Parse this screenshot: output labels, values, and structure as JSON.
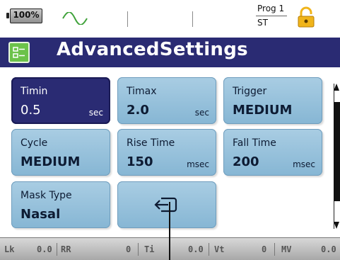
{
  "status": {
    "battery": "100%",
    "prog_label": "Prog 1",
    "mode": "ST",
    "icons": [
      "battery-icon",
      "wave-icon",
      "lock-icon"
    ]
  },
  "title": {
    "text": "AdvancedSettings",
    "icon": "settings-form-icon"
  },
  "tiles": [
    {
      "label": "Timin",
      "value": "0.5",
      "unit": "sec"
    },
    {
      "label": "Timax",
      "value": "2.0",
      "unit": "sec"
    },
    {
      "label": "Trigger",
      "value": "MEDIUM",
      "unit": ""
    },
    {
      "label": "Cycle",
      "value": "MEDIUM",
      "unit": ""
    },
    {
      "label": "Rise Time",
      "value": "150",
      "unit": "msec"
    },
    {
      "label": "Fall Time",
      "value": "200",
      "unit": "msec"
    },
    {
      "label": "Mask Type",
      "value": "Nasal",
      "unit": ""
    }
  ],
  "back_button_icon": "exit-arrow-icon",
  "monitor": [
    {
      "label": "Lk",
      "value": "0.0"
    },
    {
      "label": "RR",
      "value": "0"
    },
    {
      "label": "Ti",
      "value": "0.0"
    },
    {
      "label": "Vt",
      "value": "0"
    },
    {
      "label": "MV",
      "value": "0.0"
    }
  ],
  "colors": {
    "title_bg": "#2a2b73",
    "tile": "#9cc4dd",
    "selected": "#2a2b73",
    "accent_green": "#6cc24a"
  }
}
